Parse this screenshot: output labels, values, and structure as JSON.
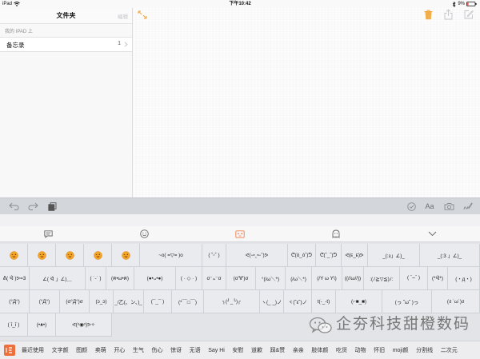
{
  "status_bar": {
    "device": "iPad",
    "time": "下午10:42",
    "battery": "9%"
  },
  "sidebar": {
    "title": "文件夹",
    "edit_label": "编辑",
    "section_header": "我的 IPAD 上",
    "folders": [
      {
        "name": "备忘录",
        "count": "1"
      }
    ]
  },
  "note_toolbar": {
    "left_icon": "expand-icon",
    "right_icons": [
      "trash-icon",
      "share-icon",
      "compose-icon"
    ]
  },
  "format_toolbar": {
    "left_icons": [
      "undo-icon",
      "redo-icon",
      "paste-icon"
    ],
    "format_label": "Aa",
    "right_icons": [
      "checklist-icon",
      "camera-icon",
      "sketch-icon"
    ]
  },
  "keyboard": {
    "tabs": [
      "chat-bubble-icon",
      "smiley-icon",
      "kaomoji-icon",
      "ghost-icon",
      "chevron-down-icon"
    ],
    "active_tab": 2,
    "rows": [
      [
        {
          "emoji": "smiling-face-emoji-icon"
        },
        {
          "emoji": "smiling-face-emoji-icon"
        },
        {
          "emoji": "smiling-face-emoji-icon"
        },
        {
          "emoji": "smiling-face-emoji-icon"
        },
        {
          "emoji": "smiling-face-emoji-icon"
        },
        {
          "text": "~o( =▽= )o"
        },
        {
          "text": "( ˘ᵕ˘ )"
        },
        {
          "text": "ᕙ(⇀‸↼‶)ᕗ"
        },
        {
          "text": "ᕦ(ò_óˇ)ᕤ"
        },
        {
          "text": "ᕦ(ˇ_ˇ)ᕤ"
        },
        {
          "text": "ᕙ(ᴇ_ᴇ)ᕗ"
        },
        {
          "text": "_(:з」∠)_"
        },
        {
          "text": "_(:3 」∠)_"
        }
      ],
      [
        {
          "text": "ᕕ( ᐛ )ᕗ=3"
        },
        {
          "text": "∠( ᐛ 」∠)＿"
        },
        {
          "text": "( ˙-˙ )"
        },
        {
          "text": "(ฅ•ω•ฅ)"
        },
        {
          "text": "(●•ᴗ•●)"
        },
        {
          "text": "( · ◇ · )"
        },
        {
          "text": "σ⁻ᴗ⁻σ"
        },
        {
          "text": "(σ'∀')σ"
        },
        {
          "text": "°(/ω＼*)"
        },
        {
          "text": "(/ω＼*)"
        },
        {
          "text": "(/Y ω Y\\)"
        },
        {
          "text": "((//ω//))"
        },
        {
          "text": ":(ﾉ≧▽≦)ﾉ:"
        },
        {
          "text": "( ˉ⌣ˉ )"
        },
        {
          "text": "(*ᐛ*)"
        },
        {
          "text": "(・д・)"
        }
      ],
      [
        {
          "text": "(°Д°)"
        },
        {
          "text": "(°Д°)"
        },
        {
          "text": "(σ°Д°)σ"
        },
        {
          "text": "(ɔ_ɔ)"
        },
        {
          "text": "_/乙(、ン、)_"
        },
        {
          "text": "(¯_¯ )"
        },
        {
          "text": "(*￣□￣)"
        },
        {
          "text": "╮(╯_╰)╭"
        },
        {
          "text": "ヽ(_ _)ノ"
        },
        {
          "text": "ヾ(˘ε˘)ノ"
        },
        {
          "text": "t(-_-t)"
        },
        {
          "text": "(⌐■_■)"
        },
        {
          "text": "(っ ˘ω˘ )っ"
        },
        {
          "text": "(ง ˙ω˙)ง"
        }
      ],
      [
        {
          "text": "( ĭ_ĭ )"
        },
        {
          "text": "(•ᴥ•)"
        },
        {
          "text": "ᕙ(ᵒ◉ᵒ)ᕗ✧"
        }
      ]
    ],
    "categories": [
      "最近使用",
      "文字颜",
      "图颜",
      "卖萌",
      "开心",
      "生气",
      "伤心",
      "惊讶",
      "无语",
      "Say Hi",
      "安慰",
      "道歉",
      "踩&赞",
      "亲亲",
      "肢体颜",
      "吃货",
      "动物",
      "怀旧",
      "moji颜",
      "分割线",
      "二次元"
    ]
  },
  "watermark": {
    "icon": "wechat-icon",
    "text": "企夯科技甜橙数码"
  },
  "colors": {
    "accent": "#eea53a",
    "tab_active": "#ee7d4a",
    "icon_gray": "#8a8a8e"
  }
}
